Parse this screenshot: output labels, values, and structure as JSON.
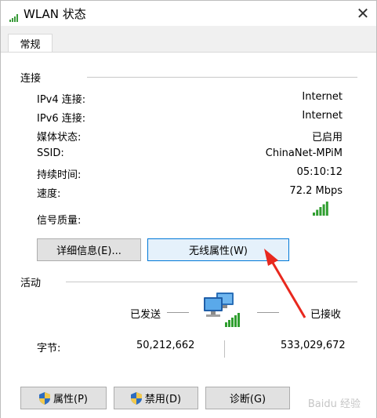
{
  "window": {
    "title": "WLAN 状态",
    "close_glyph": "✕"
  },
  "tabs": [
    {
      "label": "常规",
      "selected": true
    }
  ],
  "connection": {
    "group_title": "连接",
    "rows": [
      {
        "label": "IPv4 连接:",
        "value": "Internet"
      },
      {
        "label": "IPv6 连接:",
        "value": "Internet"
      },
      {
        "label": "媒体状态:",
        "value": "已启用"
      },
      {
        "label": "SSID:",
        "value": "ChinaNet-MPiM"
      },
      {
        "label": "持续时间:",
        "value": "05:10:12"
      },
      {
        "label": "速度:",
        "value": "72.2 Mbps"
      }
    ],
    "signal_label": "信号质量:",
    "signal_bars": 5,
    "signal_bars_max": 5,
    "details_button": "详细信息(E)...",
    "wireless_props_button": "无线属性(W)"
  },
  "activity": {
    "group_title": "活动",
    "sent_label": "已发送",
    "received_label": "已接收",
    "bytes_label": "字节:",
    "bytes_sent": "50,212,662",
    "bytes_received": "533,029,672"
  },
  "buttons": {
    "properties": "属性(P)",
    "disable": "禁用(D)",
    "diagnose": "诊断(G)"
  },
  "colors": {
    "accent": "#0078d7",
    "signal_green": "#2f9e2f",
    "arrow_red": "#e8281e"
  },
  "watermark": "Baidu 经验"
}
